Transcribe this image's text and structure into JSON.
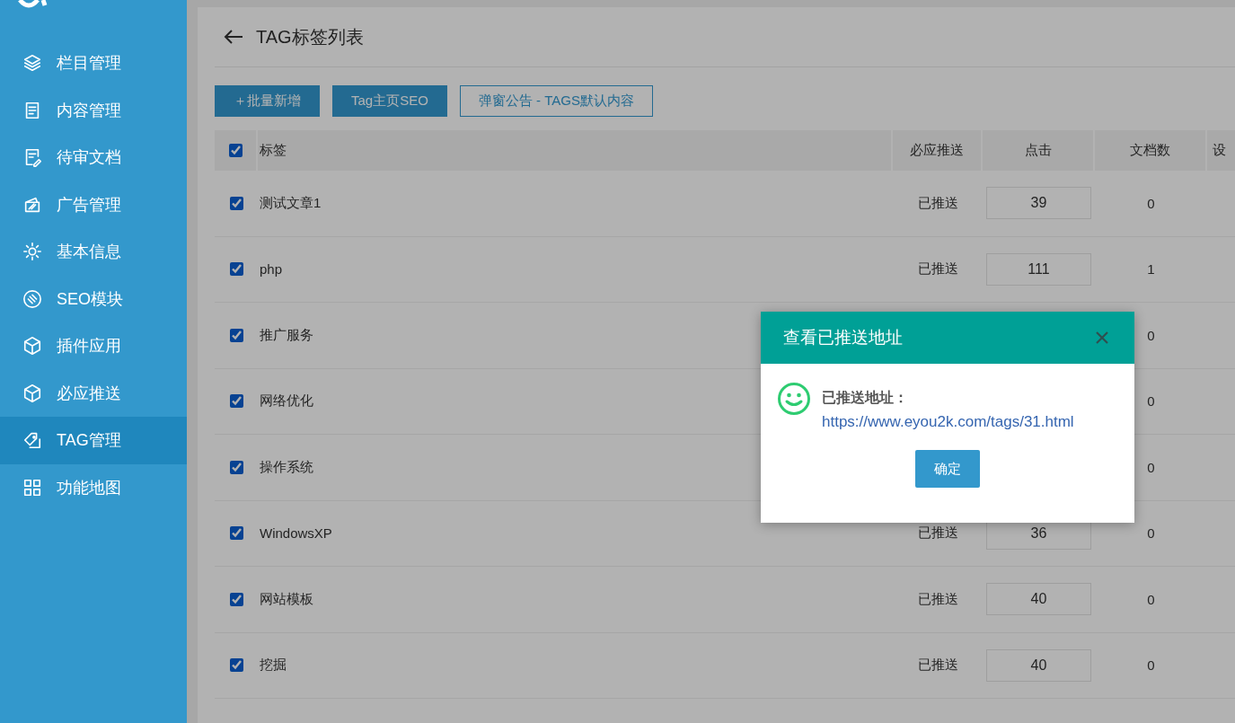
{
  "sidebar": {
    "items": [
      {
        "label": "栏目管理",
        "selected": false
      },
      {
        "label": "内容管理",
        "selected": false
      },
      {
        "label": "待审文档",
        "selected": false
      },
      {
        "label": "广告管理",
        "selected": false
      },
      {
        "label": "基本信息",
        "selected": false
      },
      {
        "label": "SEO模块",
        "selected": false
      },
      {
        "label": "插件应用",
        "selected": false
      },
      {
        "label": "必应推送",
        "selected": false
      },
      {
        "label": "TAG管理",
        "selected": true
      },
      {
        "label": "功能地图",
        "selected": false
      }
    ]
  },
  "page": {
    "title": "TAG标签列表"
  },
  "toolbar": [
    {
      "label": "＋批量新增",
      "kind": "filled"
    },
    {
      "label": "Tag主页SEO",
      "kind": "filled"
    },
    {
      "label": "弹窗公告 - TAGS默认内容",
      "kind": "outline"
    }
  ],
  "table": {
    "all_checked": true,
    "columns": [
      "标签",
      "必应推送",
      "点击",
      "文档数",
      "设"
    ],
    "rows": [
      {
        "tag": "测试文章1",
        "checked": true,
        "push": "已推送",
        "clicks": "39",
        "docs": "0"
      },
      {
        "tag": "php",
        "checked": true,
        "push": "已推送",
        "clicks": "111",
        "docs": "1"
      },
      {
        "tag": "推广服务",
        "checked": true,
        "docs": "0"
      },
      {
        "tag": "网络优化",
        "checked": true,
        "docs": "0"
      },
      {
        "tag": "操作系统",
        "checked": true,
        "docs": "0"
      },
      {
        "tag": "WindowsXP",
        "checked": true,
        "push": "已推送",
        "clicks": "36",
        "docs": "0"
      },
      {
        "tag": "网站模板",
        "checked": true,
        "push": "已推送",
        "clicks": "40",
        "docs": "0"
      },
      {
        "tag": "挖掘",
        "checked": true,
        "push": "已推送",
        "clicks": "40",
        "docs": "0"
      }
    ]
  },
  "dialog": {
    "title": "查看已推送地址",
    "label": "已推送地址：",
    "url": "https://www.eyou2k.com/tags/31.html",
    "button": "确定"
  }
}
